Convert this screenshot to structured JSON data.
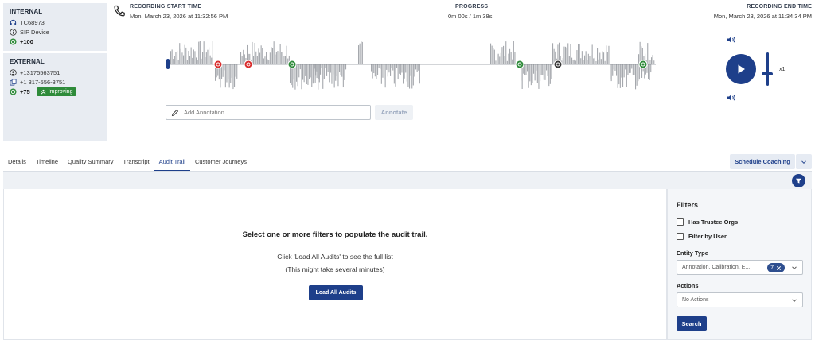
{
  "internal": {
    "title": "INTERNAL",
    "id": "TC68973",
    "device": "SIP Device",
    "score": "+100"
  },
  "external": {
    "title": "EXTERNAL",
    "phone1": "+13175563751",
    "phone2": "+1 317-556-3751",
    "score": "+75",
    "badge": "Improving"
  },
  "recording": {
    "start_label": "RECORDING START TIME",
    "start_value": "Mon, March 23, 2026 at 11:32:56 PM",
    "progress_label": "PROGRESS",
    "progress_value": "0m 00s / 1m 38s",
    "end_label": "RECORDING END TIME",
    "end_value": "Mon, March 23, 2026 at 11:34:34 PM",
    "speed": "x1"
  },
  "annotation": {
    "placeholder": "Add Annotation",
    "button": "Annotate"
  },
  "tabs": [
    {
      "label": "Details"
    },
    {
      "label": "Timeline"
    },
    {
      "label": "Quality Summary"
    },
    {
      "label": "Transcript"
    },
    {
      "label": "Audit Trail"
    },
    {
      "label": "Customer Journeys"
    }
  ],
  "active_tab": "Audit Trail",
  "schedule_coaching": "Schedule Coaching",
  "main": {
    "message": "Select one or more filters to populate the audit trail.",
    "hint1": "Click 'Load All Audits' to see the full list",
    "hint2": "(This might take several minutes)",
    "load_button": "Load All Audits"
  },
  "filters": {
    "title": "Filters",
    "has_trustee_orgs": "Has Trustee Orgs",
    "filter_by_user": "Filter by User",
    "entity_type_label": "Entity Type",
    "entity_type_value": "Annotation, Calibration, E...",
    "entity_type_count": "7",
    "actions_label": "Actions",
    "actions_value": "No Actions",
    "search_button": "Search"
  },
  "colors": {
    "primary": "#1e3f8a",
    "success": "#2e8b3a",
    "panel_bg": "#e8ecf2"
  }
}
